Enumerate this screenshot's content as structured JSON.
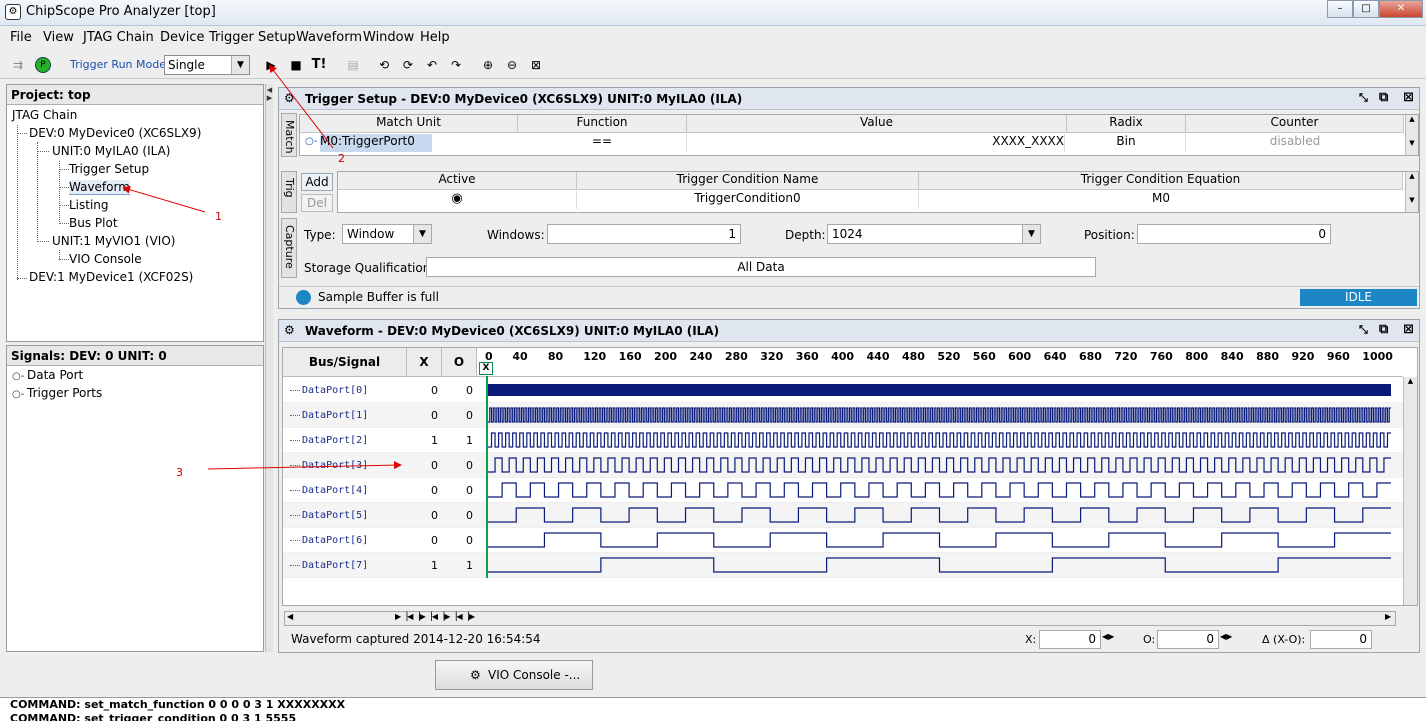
{
  "window": {
    "title": "ChipScope Pro Analyzer [top]",
    "minimize": "–",
    "maximize": "□",
    "close": "✕"
  },
  "menu": [
    "File",
    "View",
    "JTAG Chain",
    "Device",
    "Trigger Setup",
    "Waveform",
    "Window",
    "Help"
  ],
  "toolbar": {
    "run_mode_label": "Trigger Run Mode:",
    "run_mode_value": "Single",
    "run_icon": "play-icon",
    "stop_icon": "stop-icon",
    "trigger_now": "T!"
  },
  "project": {
    "title": "Project: top",
    "tree": [
      "JTAG Chain",
      "DEV:0 MyDevice0 (XC6SLX9)",
      "UNIT:0 MyILA0 (ILA)",
      "Trigger Setup",
      "Waveform",
      "Listing",
      "Bus Plot",
      "UNIT:1 MyVIO1 (VIO)",
      "VIO Console",
      "DEV:1 MyDevice1 (XCF02S)"
    ]
  },
  "signals": {
    "title": "Signals: DEV: 0 UNIT: 0",
    "items": [
      "Data Port",
      "Trigger Ports"
    ]
  },
  "trigger_setup": {
    "title": "Trigger Setup - DEV:0 MyDevice0 (XC6SLX9) UNIT:0 MyILA0 (ILA)",
    "match_tab": "Match",
    "match_headers": [
      "Match Unit",
      "Function",
      "Value",
      "Radix",
      "Counter"
    ],
    "match_row": {
      "unit": "M0:TriggerPort0",
      "function": "==",
      "value": "XXXX_XXXX",
      "radix": "Bin",
      "counter": "disabled"
    },
    "trig_tab": "Trig",
    "add": "Add",
    "del": "Del",
    "trig_headers": [
      "Active",
      "Trigger Condition Name",
      "Trigger Condition Equation"
    ],
    "trig_row": {
      "name": "TriggerCondition0",
      "equation": "M0"
    },
    "capture_tab": "Capture",
    "type_label": "Type:",
    "type_value": "Window",
    "windows_label": "Windows:",
    "windows_value": "1",
    "depth_label": "Depth:",
    "depth_value": "1024",
    "position_label": "Position:",
    "position_value": "0",
    "storage_label": "Storage Qualification:",
    "storage_value": "All Data",
    "status": "Sample Buffer is full",
    "state": "IDLE"
  },
  "waveform": {
    "title": "Waveform - DEV:0 MyDevice0 (XC6SLX9) UNIT:0 MyILA0 (ILA)",
    "col_bus": "Bus/Signal",
    "col_x": "X",
    "col_o": "O",
    "ticks": [
      "0",
      "40",
      "80",
      "120",
      "160",
      "200",
      "240",
      "280",
      "320",
      "360",
      "400",
      "440",
      "480",
      "520",
      "560",
      "600",
      "640",
      "680",
      "720",
      "760",
      "800",
      "840",
      "880",
      "920",
      "960",
      "1000"
    ],
    "signals": [
      {
        "name": "DataPort[0]",
        "x": "0",
        "o": "0",
        "half_period": 1
      },
      {
        "name": "DataPort[1]",
        "x": "0",
        "o": "0",
        "half_period": 2
      },
      {
        "name": "DataPort[2]",
        "x": "1",
        "o": "1",
        "half_period": 4
      },
      {
        "name": "DataPort[3]",
        "x": "0",
        "o": "0",
        "half_period": 8
      },
      {
        "name": "DataPort[4]",
        "x": "0",
        "o": "0",
        "half_period": 16
      },
      {
        "name": "DataPort[5]",
        "x": "0",
        "o": "0",
        "half_period": 32
      },
      {
        "name": "DataPort[6]",
        "x": "0",
        "o": "0",
        "half_period": 64
      },
      {
        "name": "DataPort[7]",
        "x": "1",
        "o": "1",
        "half_period": 128
      }
    ],
    "captured": "Waveform captured 2014-12-20 16:54:54",
    "cursor_x_label": "X:",
    "cursor_x_value": "0",
    "cursor_o_label": "O:",
    "cursor_o_value": "0",
    "delta_label": "Δ (X-O):",
    "delta_value": "0"
  },
  "vio_button": "VIO Console -...",
  "console": [
    "COMMAND: set_match_function 0 0 0 0 3 1 XXXXXXXX",
    "COMMAND: set_trigger_condition 0 0 3 1 5555"
  ],
  "annotations": [
    "1",
    "2",
    "3"
  ],
  "colors": {
    "accent": "#1a73c9",
    "wave": "#0a1a78",
    "idle": "#1d86c4"
  }
}
